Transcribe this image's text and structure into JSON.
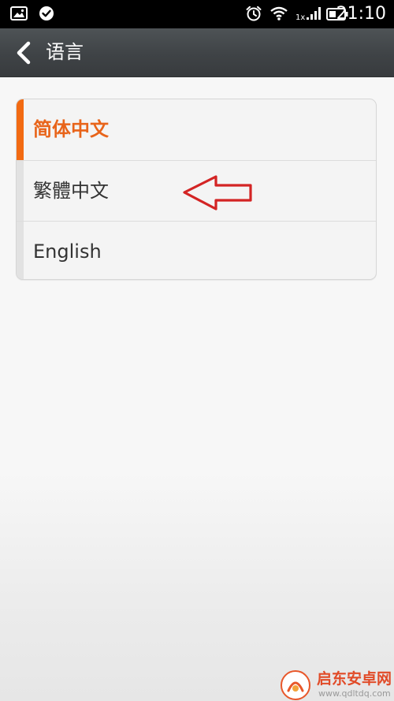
{
  "status_bar": {
    "time": "21:10",
    "network_label": "1x",
    "icons": [
      "image-notification-icon",
      "check-notification-icon",
      "alarm-icon",
      "wifi-icon",
      "signal-icon",
      "battery-icon"
    ]
  },
  "action_bar": {
    "title": "语言",
    "back_icon": "chevron-left-icon"
  },
  "languages": {
    "items": [
      {
        "label": "简体中文",
        "selected": true
      },
      {
        "label": "繁體中文",
        "selected": false
      },
      {
        "label": "English",
        "selected": false
      }
    ]
  },
  "annotation": {
    "icon": "red-arrow-left-icon",
    "color": "#d32424"
  },
  "watermark": {
    "name": "启东安卓网",
    "url": "www.qdltdq.com"
  },
  "colors": {
    "accent": "#f26a12",
    "selected_text": "#e8641a",
    "status_bar": "#000000",
    "action_bar": "#3f4346"
  }
}
